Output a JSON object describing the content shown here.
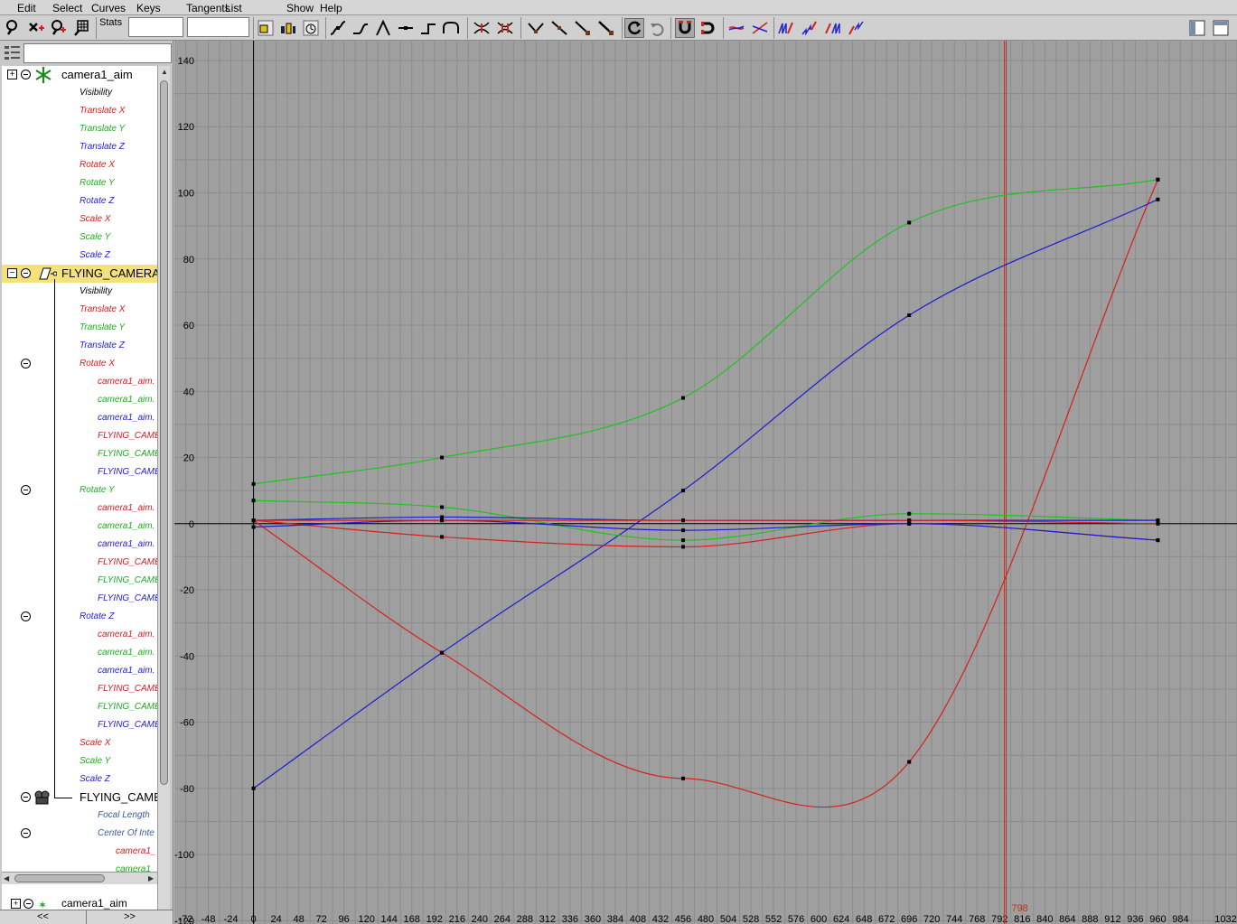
{
  "menu": [
    "Edit",
    "Select",
    "Curves",
    "Keys",
    "Tangents",
    "List",
    "Show",
    "Help"
  ],
  "toolbar": {
    "stats_label": "Stats",
    "stats_value_1": "",
    "stats_value_2": ""
  },
  "outliner": {
    "filter_value": "",
    "rows": [
      {
        "label": "camera1_aim",
        "kind": "node",
        "color": "black",
        "icon": "aim-locator-icon",
        "expander": "plus"
      },
      {
        "label": "Visibility",
        "color": "black"
      },
      {
        "label": "Translate X",
        "color": "red"
      },
      {
        "label": "Translate Y",
        "color": "green"
      },
      {
        "label": "Translate Z",
        "color": "blue"
      },
      {
        "label": "Rotate X",
        "color": "red"
      },
      {
        "label": "Rotate Y",
        "color": "green"
      },
      {
        "label": "Rotate Z",
        "color": "blue"
      },
      {
        "label": "Scale X",
        "color": "red"
      },
      {
        "label": "Scale Y",
        "color": "green"
      },
      {
        "label": "Scale Z",
        "color": "blue"
      },
      {
        "label": "FLYING_CAMERA",
        "kind": "node",
        "color": "black",
        "icon": "camera-transform-icon",
        "expander": "minus",
        "selected": true
      },
      {
        "label": "Visibility",
        "color": "black"
      },
      {
        "label": "Translate X",
        "color": "red"
      },
      {
        "label": "Translate Y",
        "color": "green"
      },
      {
        "label": "Translate Z",
        "color": "blue"
      },
      {
        "label": "Rotate X",
        "color": "red",
        "collapse": true
      },
      {
        "label": "camera1_aim.",
        "color": "red",
        "indent": 2
      },
      {
        "label": "camera1_aim.",
        "color": "green",
        "indent": 2
      },
      {
        "label": "camera1_aim.",
        "color": "blue",
        "indent": 2
      },
      {
        "label": "FLYING_CAME",
        "color": "red",
        "indent": 2
      },
      {
        "label": "FLYING_CAME",
        "color": "green",
        "indent": 2
      },
      {
        "label": "FLYING_CAME",
        "color": "blue",
        "indent": 2
      },
      {
        "label": "Rotate Y",
        "color": "green",
        "collapse": true
      },
      {
        "label": "camera1_aim.",
        "color": "red",
        "indent": 2
      },
      {
        "label": "camera1_aim.",
        "color": "green",
        "indent": 2
      },
      {
        "label": "camera1_aim.",
        "color": "blue",
        "indent": 2
      },
      {
        "label": "FLYING_CAME",
        "color": "red",
        "indent": 2
      },
      {
        "label": "FLYING_CAME",
        "color": "green",
        "indent": 2
      },
      {
        "label": "FLYING_CAME",
        "color": "blue",
        "indent": 2
      },
      {
        "label": "Rotate Z",
        "color": "blue",
        "collapse": true
      },
      {
        "label": "camera1_aim.",
        "color": "red",
        "indent": 2
      },
      {
        "label": "camera1_aim.",
        "color": "green",
        "indent": 2
      },
      {
        "label": "camera1_aim.",
        "color": "blue",
        "indent": 2
      },
      {
        "label": "FLYING_CAME",
        "color": "red",
        "indent": 2
      },
      {
        "label": "FLYING_CAME",
        "color": "green",
        "indent": 2
      },
      {
        "label": "FLYING_CAME",
        "color": "blue",
        "indent": 2
      },
      {
        "label": "Scale X",
        "color": "red"
      },
      {
        "label": "Scale Y",
        "color": "green"
      },
      {
        "label": "Scale Z",
        "color": "blue"
      },
      {
        "label": "FLYING_CAME",
        "kind": "node",
        "color": "black",
        "icon": "camera-shape-icon",
        "collapse": true,
        "indent": 1
      },
      {
        "label": "Focal Length",
        "color": "gray",
        "indent": 2
      },
      {
        "label": "Center Of Inte",
        "color": "gray",
        "indent": 2,
        "collapse": true
      },
      {
        "label": "camera1_",
        "color": "red",
        "indent": 3
      },
      {
        "label": "camera1_",
        "color": "green",
        "indent": 3
      }
    ],
    "peek_label": "camera1_aim",
    "nav_prev": "<<",
    "nav_next": ">>"
  },
  "graph": {
    "x_ticks": [
      -72,
      -48,
      -24,
      0,
      24,
      48,
      72,
      96,
      120,
      144,
      168,
      192,
      216,
      240,
      264,
      288,
      312,
      336,
      360,
      384,
      408,
      432,
      456,
      480,
      504,
      528,
      552,
      576,
      600,
      624,
      648,
      672,
      696,
      720,
      744,
      768,
      792,
      816,
      840,
      864,
      888,
      912,
      936,
      960,
      984,
      1032
    ],
    "y_ticks": [
      140,
      120,
      100,
      80,
      60,
      40,
      20,
      0,
      -20,
      -40,
      -60,
      -80,
      -100,
      -120
    ],
    "current_time": 798,
    "current_time_label": "798",
    "colors": {
      "background": "#9f9f9f",
      "grid": "#8c8c8c",
      "red": "#d42020",
      "green": "#22c022",
      "blue": "#1c1cd0",
      "time": "#c03020"
    }
  },
  "chart_data": {
    "type": "line",
    "xlabel": "",
    "ylabel": "",
    "xlim": [
      -84,
      1044
    ],
    "ylim": [
      -121,
      146
    ],
    "grid": true,
    "series": [
      {
        "color": "red",
        "keys": [
          [
            0,
            1
          ],
          [
            200,
            -39
          ],
          [
            456,
            -77
          ],
          [
            696,
            -72
          ],
          [
            960,
            104
          ]
        ]
      },
      {
        "color": "green",
        "keys": [
          [
            0,
            12
          ],
          [
            200,
            20
          ],
          [
            456,
            38
          ],
          [
            696,
            91
          ],
          [
            960,
            104
          ]
        ]
      },
      {
        "color": "blue",
        "keys": [
          [
            0,
            -80
          ],
          [
            200,
            -39
          ],
          [
            456,
            10
          ],
          [
            696,
            63
          ],
          [
            960,
            98
          ]
        ]
      },
      {
        "color": "red",
        "keys": [
          [
            0,
            1
          ],
          [
            200,
            -4
          ],
          [
            456,
            -7
          ],
          [
            696,
            0
          ],
          [
            960,
            -5
          ]
        ]
      },
      {
        "color": "green",
        "keys": [
          [
            0,
            7
          ],
          [
            200,
            5
          ],
          [
            456,
            -5
          ],
          [
            696,
            3
          ],
          [
            960,
            1
          ]
        ]
      },
      {
        "color": "blue",
        "keys": [
          [
            0,
            -1
          ],
          [
            200,
            1
          ],
          [
            456,
            -2
          ],
          [
            696,
            0
          ],
          [
            960,
            -5
          ]
        ]
      },
      {
        "color": "blue",
        "keys": [
          [
            0,
            1
          ],
          [
            200,
            2
          ],
          [
            456,
            1
          ],
          [
            696,
            1
          ],
          [
            960,
            1
          ]
        ]
      },
      {
        "color": "red",
        "keys": [
          [
            0,
            1
          ],
          [
            200,
            1
          ],
          [
            456,
            1
          ],
          [
            696,
            1
          ],
          [
            960,
            0
          ]
        ]
      }
    ]
  }
}
